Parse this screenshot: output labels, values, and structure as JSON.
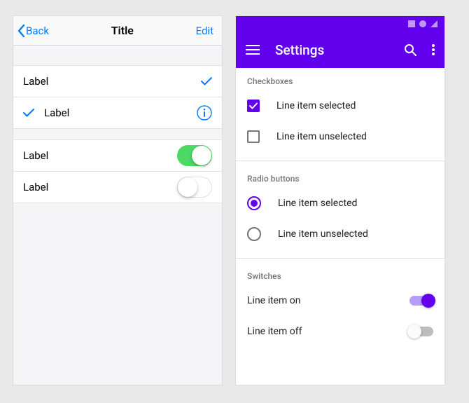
{
  "ios": {
    "back_label": "Back",
    "title": "Title",
    "edit_label": "Edit",
    "rows": [
      {
        "label": "Label"
      },
      {
        "label": "Label"
      },
      {
        "label": "Label"
      },
      {
        "label": "Label"
      }
    ]
  },
  "android": {
    "appbar_title": "Settings",
    "sections": {
      "checkboxes": {
        "title": "Checkboxes",
        "items": [
          {
            "label": "Line item selected"
          },
          {
            "label": "Line item unselected"
          }
        ]
      },
      "radios": {
        "title": "Radio buttons",
        "items": [
          {
            "label": "Line item selected"
          },
          {
            "label": "Line item unselected"
          }
        ]
      },
      "switches": {
        "title": "Switches",
        "items": [
          {
            "label": "Line item on"
          },
          {
            "label": "Line item off"
          }
        ]
      }
    }
  },
  "colors": {
    "ios_tint": "#007aff",
    "ios_switch_on": "#4cd964",
    "android_primary": "#6200ee"
  }
}
